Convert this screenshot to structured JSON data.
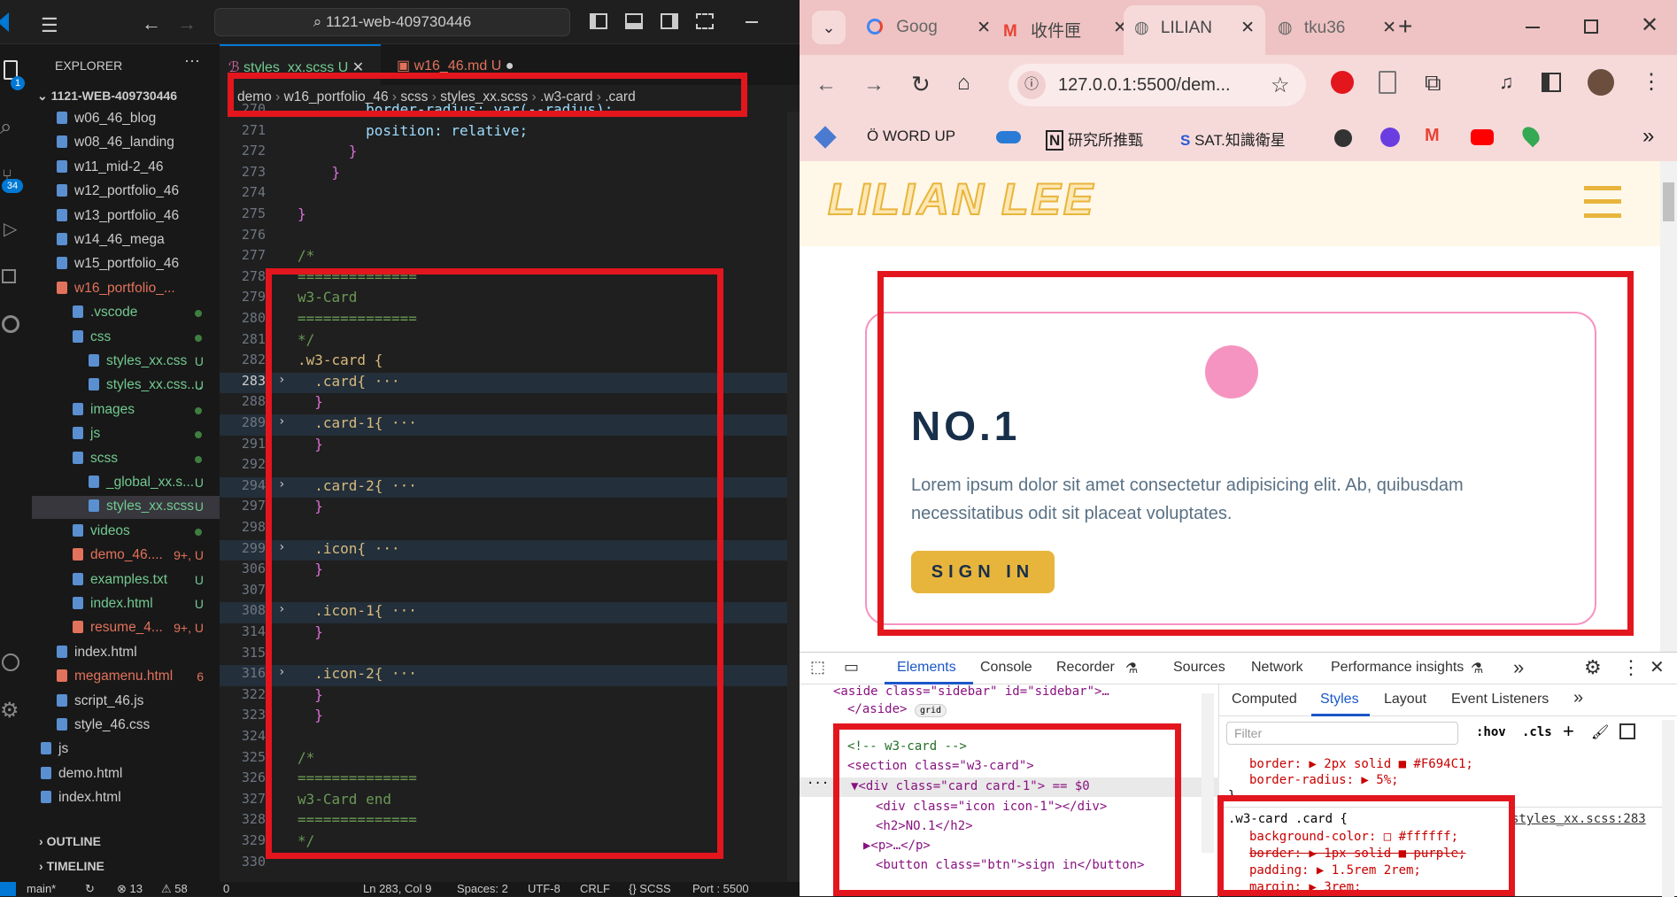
{
  "vscode": {
    "search": "1121-web-409730446",
    "explorer_title": "EXPLORER",
    "root": "1121-WEB-409730446",
    "tree": [
      {
        "label": "w06_46_blog",
        "indent": 0,
        "color": "#cccccc"
      },
      {
        "label": "w08_46_landing",
        "indent": 0,
        "color": "#cccccc"
      },
      {
        "label": "w11_mid-2_46",
        "indent": 0,
        "color": "#cccccc"
      },
      {
        "label": "w12_portfolio_46",
        "indent": 0,
        "color": "#cccccc"
      },
      {
        "label": "w13_portfolio_46",
        "indent": 0,
        "color": "#cccccc"
      },
      {
        "label": "w14_46_mega",
        "indent": 0,
        "color": "#cccccc"
      },
      {
        "label": "w15_portfolio_46",
        "indent": 0,
        "color": "#cccccc"
      },
      {
        "label": "w16_portfolio_...",
        "indent": 0,
        "color": "#e2725b"
      },
      {
        "label": ".vscode",
        "indent": 1,
        "color": "#73c991"
      },
      {
        "label": "css",
        "indent": 1,
        "color": "#73c991"
      },
      {
        "label": "styles_xx.css",
        "indent": 2,
        "color": "#73c991",
        "badge": "U"
      },
      {
        "label": "styles_xx.css....",
        "indent": 2,
        "color": "#73c991",
        "badge": "U"
      },
      {
        "label": "images",
        "indent": 1,
        "color": "#73c991"
      },
      {
        "label": "js",
        "indent": 1,
        "color": "#73c991"
      },
      {
        "label": "scss",
        "indent": 1,
        "color": "#73c991"
      },
      {
        "label": "_global_xx.s...",
        "indent": 2,
        "color": "#73c991",
        "badge": "U"
      },
      {
        "label": "styles_xx.scss",
        "indent": 2,
        "color": "#73c991",
        "badge": "U"
      },
      {
        "label": "videos",
        "indent": 1,
        "color": "#73c991"
      },
      {
        "label": "demo_46....",
        "indent": 1,
        "color": "#e2725b",
        "badge": "9+, U"
      },
      {
        "label": "examples.txt",
        "indent": 1,
        "color": "#73c991",
        "badge": "U"
      },
      {
        "label": "index.html",
        "indent": 1,
        "color": "#73c991",
        "badge": "U"
      },
      {
        "label": "resume_4...",
        "indent": 1,
        "color": "#e2725b",
        "badge": "9+, U"
      },
      {
        "label": "index.html",
        "indent": 0,
        "color": "#cccccc"
      },
      {
        "label": "megamenu.html",
        "indent": 0,
        "color": "#e2725b",
        "badge": "6"
      },
      {
        "label": "script_46.js",
        "indent": 0,
        "color": "#cccccc"
      },
      {
        "label": "style_46.css",
        "indent": 0,
        "color": "#cccccc"
      },
      {
        "label": "js",
        "indent": -1,
        "color": "#cccccc"
      },
      {
        "label": "demo.html",
        "indent": -1,
        "color": "#cccccc"
      },
      {
        "label": "index.html",
        "indent": -1,
        "color": "#cccccc"
      }
    ],
    "outline": "OUTLINE",
    "timeline": "TIMELINE",
    "tabs": [
      {
        "label": "styles_xx.scss",
        "suffix": "U"
      },
      {
        "label": "w16_46.md",
        "suffix": "U"
      }
    ],
    "breadcrumb": [
      "demo",
      "w16_portfolio_46",
      "scss",
      "styles_xx.scss",
      ".w3-card",
      ".card"
    ],
    "lines": [
      {
        "n": "270",
        "t": "        border-radius: var(--radius);"
      },
      {
        "n": "271",
        "t": "        position: relative;"
      },
      {
        "n": "272",
        "t": "      }"
      },
      {
        "n": "273",
        "t": "    }"
      },
      {
        "n": "274",
        "t": ""
      },
      {
        "n": "275",
        "t": "}"
      },
      {
        "n": "276",
        "t": ""
      },
      {
        "n": "277",
        "t": "/*"
      },
      {
        "n": "278",
        "t": "=============="
      },
      {
        "n": "279",
        "t": "w3-Card"
      },
      {
        "n": "280",
        "t": "=============="
      },
      {
        "n": "281",
        "t": "*/"
      },
      {
        "n": "282",
        "t": ".w3-card {"
      },
      {
        "n": "283",
        "t": "  .card{ ···"
      },
      {
        "n": "288",
        "t": "  }"
      },
      {
        "n": "289",
        "t": "  .card-1{ ···"
      },
      {
        "n": "291",
        "t": "  }"
      },
      {
        "n": "292",
        "t": ""
      },
      {
        "n": "294",
        "t": "  .card-2{ ···"
      },
      {
        "n": "297",
        "t": "  }"
      },
      {
        "n": "298",
        "t": ""
      },
      {
        "n": "299",
        "t": "  .icon{ ···"
      },
      {
        "n": "306",
        "t": "  }"
      },
      {
        "n": "307",
        "t": ""
      },
      {
        "n": "308",
        "t": "  .icon-1{ ···"
      },
      {
        "n": "314",
        "t": "  }"
      },
      {
        "n": "315",
        "t": ""
      },
      {
        "n": "316",
        "t": "  .icon-2{ ···"
      },
      {
        "n": "322",
        "t": "  }"
      },
      {
        "n": "323",
        "t": "  }"
      },
      {
        "n": "324",
        "t": ""
      },
      {
        "n": "325",
        "t": "/*"
      },
      {
        "n": "326",
        "t": "=============="
      },
      {
        "n": "327",
        "t": "w3-Card end"
      },
      {
        "n": "328",
        "t": "=============="
      },
      {
        "n": "329",
        "t": "*/"
      },
      {
        "n": "330",
        "t": ""
      }
    ],
    "status": {
      "branch": "main*",
      "errors": "⊗ 13",
      "warnings": "⚠ 58",
      "ports": "0",
      "pos": "Ln 283, Col 9",
      "spaces": "Spaces: 2",
      "enc": "UTF-8",
      "eol": "CRLF",
      "lang": "{} SCSS",
      "port": "Port : 5500"
    },
    "activity_badges": {
      "explorer": "1",
      "git": "34"
    }
  },
  "chrome": {
    "tabs": [
      {
        "label": "Goog"
      },
      {
        "label": "收件匣"
      },
      {
        "label": "LILIAN"
      },
      {
        "label": "tku36"
      }
    ],
    "url": "127.0.0.1:5500/dem...",
    "bookmarks": [
      "WORD UP",
      "研究所推甄",
      "SAT.知識衛星"
    ],
    "page": {
      "logo": "LILIAN LEE",
      "card_title": "NO.1",
      "card_text": "Lorem ipsum dolor sit amet consectetur adipisicing elit. Ab, quibusdam necessitatibus odit sit placeat voluptates.",
      "button": "SIGN IN"
    },
    "devtools": {
      "tabs": [
        "Elements",
        "Console",
        "Recorder",
        "Sources",
        "Network",
        "Performance insights"
      ],
      "side_tabs": [
        "Computed",
        "Styles",
        "Layout",
        "Event Listeners"
      ],
      "filter_placeholder": "Filter",
      "hov": ":hov",
      "cls": ".cls",
      "dom": [
        "<aside class=\"sidebar\" id=\"sidebar\">…",
        "</aside>",
        "<!-- w3-card -->",
        "<section class=\"w3-card\">",
        "▼<div class=\"card card-1\"> == $0",
        "<div class=\"icon icon-1\"></div>",
        "<h2>NO.1</h2>",
        "▶<p>…</p>",
        "<button class=\"btn\">sign in</button>"
      ],
      "grid_badge": "grid",
      "styles_top": [
        "border: ▶ 2px solid ■ #F694C1;",
        "border-radius: ▶ 5%;",
        "}"
      ],
      "rule_selector": ".w3-card .card {",
      "rule_source": "styles_xx.scss:283",
      "rule_props": [
        "background-color: □ #ffffff;",
        "border: ▶ 1px solid ■ purple;",
        "padding: ▶ 1.5rem 2rem;",
        "margin: ▶ 3rem;"
      ]
    }
  },
  "colors": {
    "accent": "#e3161e",
    "vs_blue": "#0078d4",
    "gold": "#e8b53c",
    "pink": "#f694c1",
    "navy": "#182f4a"
  }
}
